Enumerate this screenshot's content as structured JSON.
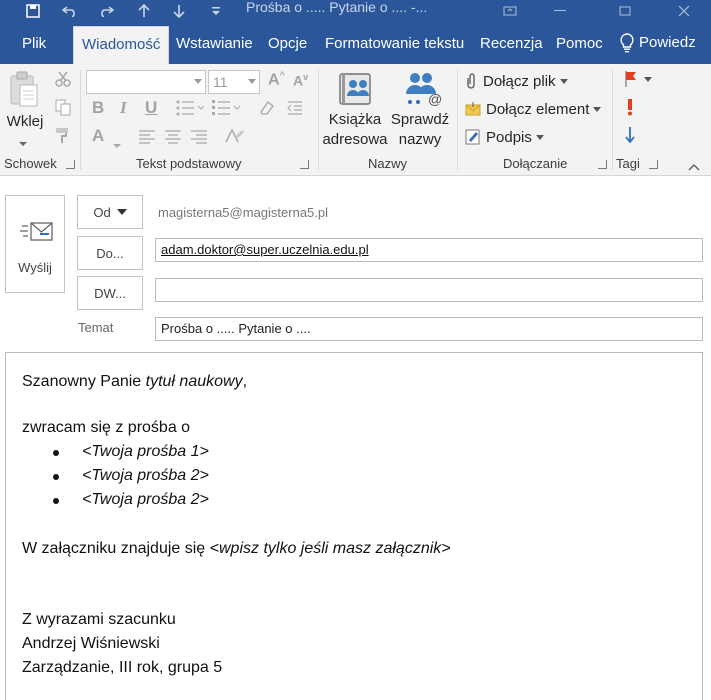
{
  "window": {
    "title": "Prośba o .....  Pytanie o ....  -..."
  },
  "quick_access": {
    "icons": [
      "save-icon",
      "undo-icon",
      "redo-icon",
      "up-arrow-icon",
      "down-arrow-icon",
      "customize-icon"
    ]
  },
  "tabs": [
    {
      "label": "Plik",
      "active": false
    },
    {
      "label": "Wiadomość",
      "active": true
    },
    {
      "label": "Wstawianie",
      "active": false
    },
    {
      "label": "Opcje",
      "active": false
    },
    {
      "label": "Formatowanie tekstu",
      "active": false
    },
    {
      "label": "Recenzja",
      "active": false
    },
    {
      "label": "Pomoc",
      "active": false
    }
  ],
  "tell_me": {
    "label": "Powiedz"
  },
  "ribbon": {
    "clipboard": {
      "paste_label": "Wklej",
      "group_label": "Schowek"
    },
    "basic_text": {
      "font_name_value": "",
      "font_size_value": "11",
      "grow_font_label": "A",
      "shrink_font_label": "A",
      "bold_label": "B",
      "italic_label": "I",
      "underline_label": "U",
      "font_color_label": "A",
      "group_label": "Tekst podstawowy"
    },
    "names": {
      "address_book_line1": "Książka",
      "address_book_line2": "adresowa",
      "check_names_line1": "Sprawdź",
      "check_names_line2": "nazwy",
      "group_label": "Nazwy"
    },
    "include": {
      "attach_file": "Dołącz plik",
      "attach_item": "Dołącz element",
      "signature": "Podpis",
      "group_label": "Dołączanie"
    },
    "tags": {
      "group_label": "Tagi"
    }
  },
  "compose": {
    "send_label": "Wyślij",
    "from_label": "Od",
    "from_value": "magisterna5@magisterna5.pl",
    "to_label": "Do...",
    "to_value": "adam.doktor@super.uczelnia.edu.pl",
    "cc_label": "DW...",
    "cc_value": "",
    "subject_label": "Temat",
    "subject_value": "Prośba o .....  Pytanie o ...."
  },
  "body": {
    "greeting_prefix": "Szanowny Panie ",
    "greeting_title": "tytuł naukowy",
    "greeting_suffix": ",",
    "intro": "zwracam się z prośba o",
    "bullets": [
      "<Twoja prośba 1>",
      "<Twoja prośba 2>",
      "<Twoja prośba 2>"
    ],
    "attachment_prefix": "W załączniku znajduje się ",
    "attachment_note": "<wpisz tylko jeśli masz załącznik>",
    "closing": "Z wyrazami szacunku",
    "signature_name": "Andrzej Wiśniewski",
    "signature_info": "Zarządzanie, III rok, grupa 5"
  },
  "colors": {
    "accent": "#2b579a",
    "ribbon_bg": "#f3f3f3",
    "tag_red": "#e0401f",
    "tag_blue": "#2f6ebd"
  }
}
